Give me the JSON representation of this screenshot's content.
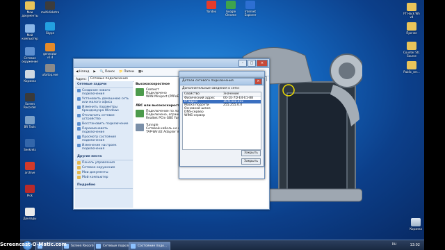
{
  "desktop": {
    "icons_left": [
      {
        "label": "Мои документы"
      },
      {
        "label": "Мой компьютер"
      },
      {
        "label": "Сетевое окружение"
      },
      {
        "label": "Корзина"
      },
      {
        "label": "Screen Recorder"
      },
      {
        "label": "BR Tools"
      },
      {
        "label": "Seekrets"
      },
      {
        "label": "archive"
      },
      {
        "label": "Pick"
      },
      {
        "label": "Доклады"
      }
    ],
    "icons_col2": [
      {
        "label": "multidiskstra"
      },
      {
        "label": "Skype"
      },
      {
        "label": "generator v1.4"
      },
      {
        "label": "ufortop.exe"
      }
    ],
    "icons_top": [
      {
        "label": "Yandex"
      },
      {
        "label": "Google Chrome"
      },
      {
        "label": "Internet Explorer"
      }
    ],
    "icons_right": [
      {
        "label": "FT Hack Wh v4"
      },
      {
        "label": "Прочее"
      },
      {
        "label": "Counter Str. Source"
      },
      {
        "label": "Public_ser..."
      }
    ],
    "recycle": "Корзина"
  },
  "explorer": {
    "title": "Сетевые подключения",
    "toolbar": {
      "back": "Назад",
      "search": "Поиск",
      "folders": "Папки"
    },
    "address_label": "Адрес:",
    "address_value": "Сетевые подключения",
    "network_tasks_title": "Сетевые задачи",
    "network_tasks": [
      "Создание нового подключения",
      "Установить домашнюю сеть или малого офиса",
      "Изменить параметры брандмауэра Windows",
      "Отключить сетевое устройство",
      "Восстановить подключение",
      "Переименовать подключение",
      "Просмотр состояния подключения",
      "Изменение настроек подключения"
    ],
    "other_places_title": "Другие места",
    "other_places": [
      "Панель управления",
      "Сетевое окружение",
      "Мои документы",
      "Мой компьютер"
    ],
    "details_title": "Подробно",
    "group_highspeed": "Высокоскоростное",
    "conn1_name": "Связист",
    "conn1_status": "Подключено",
    "conn1_device": "WAN Miniport (PPPoE)",
    "group_lan": "ЛВС или высокоскоростной Интернет",
    "conn2_name": "Подключение по локальной сети",
    "conn2_status": "Подключено, ограничено",
    "conn2_device": "Realtek PCIe GBE Family Controller",
    "conn3_name": "Tunngle",
    "conn3_status": "Сетевой кабель не подключен",
    "conn3_device": "TAP-Win32 Adapter V9 (Tunngle)"
  },
  "dialog": {
    "title": "Детали сетевого подключения",
    "subtitle": "Дополнительные сведения о сети:",
    "col_property": "Свойство",
    "col_value": "Значение",
    "rows": [
      {
        "property": "Физический адрес",
        "value": "00-1E-7D-E4-E1-88"
      },
      {
        "property": "IP-адрес",
        "value": "10.0.xxx.xxx"
      },
      {
        "property": "Маска подсети",
        "value": "255.255.0.0"
      },
      {
        "property": "Основной шлюз",
        "value": ""
      },
      {
        "property": "DNS-сервер",
        "value": ""
      },
      {
        "property": "WINS-сервер",
        "value": ""
      }
    ],
    "close_label": "Закрыть",
    "close2_label": "Закрыть"
  },
  "taskbar": {
    "buttons": [
      "",
      "Screen Recorder",
      "Сетевые подключ...",
      "Состояние подк..."
    ],
    "lang": "RU",
    "clock": "13:02"
  },
  "watermark": "Screencast-O-Matic.com"
}
